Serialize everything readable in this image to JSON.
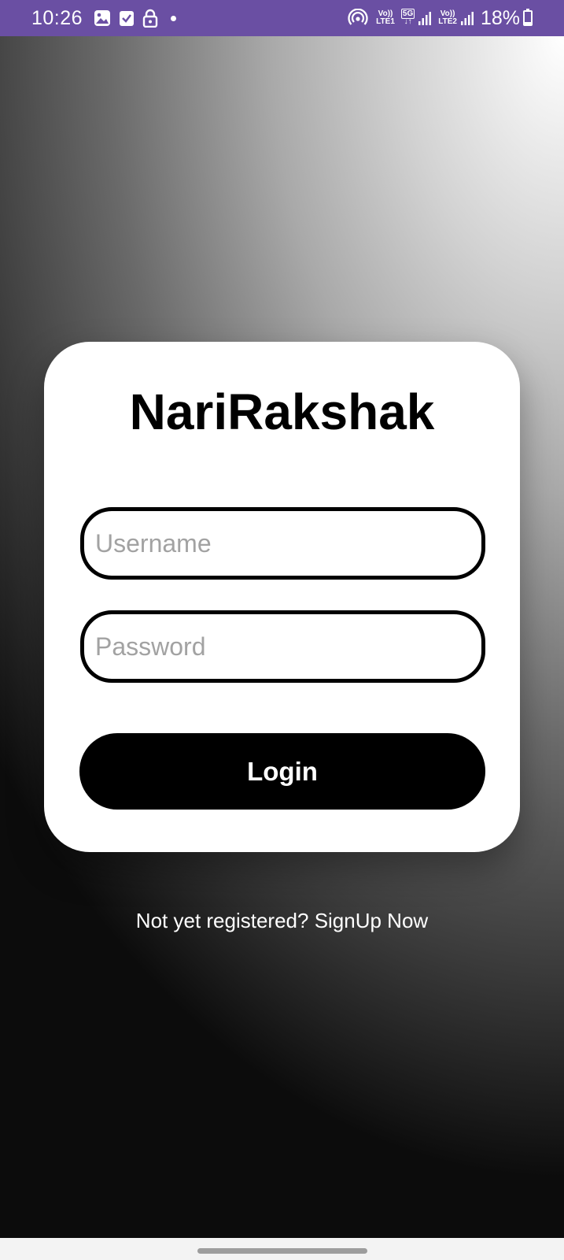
{
  "status_bar": {
    "time": "10:26",
    "left_icons": [
      "image-icon",
      "check-square-icon",
      "lock-icon",
      "dot-icon"
    ],
    "network_1_line1": "Vo))",
    "network_1_line2": "LTE1",
    "network_5g": "5G",
    "network_2_line1": "Vo))",
    "network_2_line2": "LTE2",
    "battery_percent": "18%",
    "battery_level": 0.18,
    "background_color": "#6a4fa3"
  },
  "login_card": {
    "app_title": "NariRakshak",
    "username": {
      "value": "",
      "placeholder": "Username"
    },
    "password": {
      "value": "",
      "placeholder": "Password"
    },
    "login_label": "Login"
  },
  "signup_text": "Not yet registered? SignUp Now",
  "colors": {
    "card": "#ffffff",
    "button": "#000000",
    "button_text": "#ffffff",
    "placeholder": "#a2a2a2"
  }
}
